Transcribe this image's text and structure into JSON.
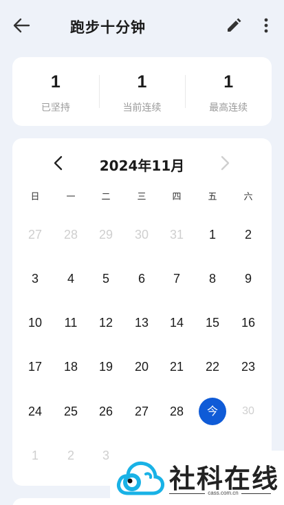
{
  "header": {
    "title": "跑步十分钟",
    "back_icon": "arrow-left-icon",
    "edit_icon": "pencil-icon",
    "more_icon": "more-vertical-icon"
  },
  "stats": [
    {
      "value": "1",
      "label": "已坚持"
    },
    {
      "value": "1",
      "label": "当前连续"
    },
    {
      "value": "1",
      "label": "最高连续"
    }
  ],
  "calendar": {
    "title": "2024年11月",
    "weekdays": [
      "日",
      "一",
      "二",
      "三",
      "四",
      "五",
      "六"
    ],
    "rows": [
      [
        "27",
        "28",
        "29",
        "30",
        "31",
        "1",
        "2"
      ],
      [
        "3",
        "4",
        "5",
        "6",
        "7",
        "8",
        "9"
      ],
      [
        "10",
        "11",
        "12",
        "13",
        "14",
        "15",
        "16"
      ],
      [
        "17",
        "18",
        "19",
        "20",
        "21",
        "22",
        "23"
      ],
      [
        "24",
        "25",
        "26",
        "27",
        "28",
        "今",
        "30"
      ],
      [
        "1",
        "2",
        "3"
      ]
    ],
    "today_label": "今",
    "colors": {
      "today": "#0f5bd7",
      "muted": "#cfcfcf",
      "background": "#eef2f9"
    }
  },
  "watermark": {
    "text": "社科在线",
    "url": "cass.com.cn"
  }
}
